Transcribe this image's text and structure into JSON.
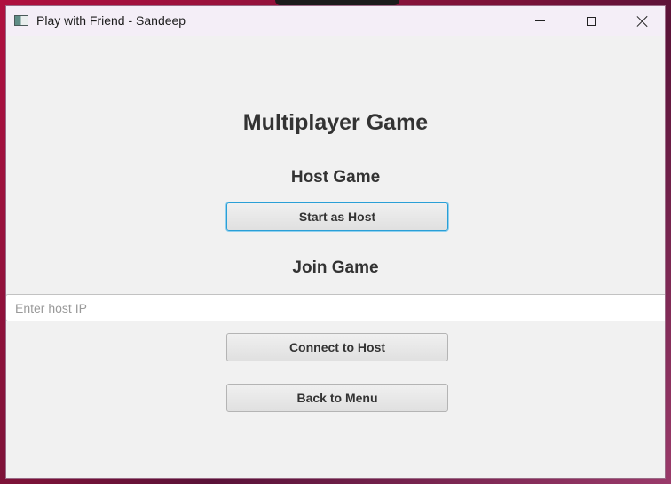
{
  "window": {
    "title": "Play with Friend - Sandeep"
  },
  "screen": {
    "title": "Multiplayer Game",
    "host_section": {
      "heading": "Host Game",
      "button_label": "Start as Host"
    },
    "join_section": {
      "heading": "Join Game",
      "ip_input": {
        "value": "",
        "placeholder": "Enter host IP"
      },
      "connect_label": "Connect to Host"
    },
    "back_label": "Back to Menu"
  },
  "icons": {
    "app": "app-window-icon",
    "minimize": "minimize-icon",
    "maximize": "maximize-icon",
    "close": "close-icon"
  },
  "colors": {
    "focus_accent": "#2a9fd6",
    "window_background": "#f1f1f1",
    "titlebar_background": "#f4eef7"
  }
}
